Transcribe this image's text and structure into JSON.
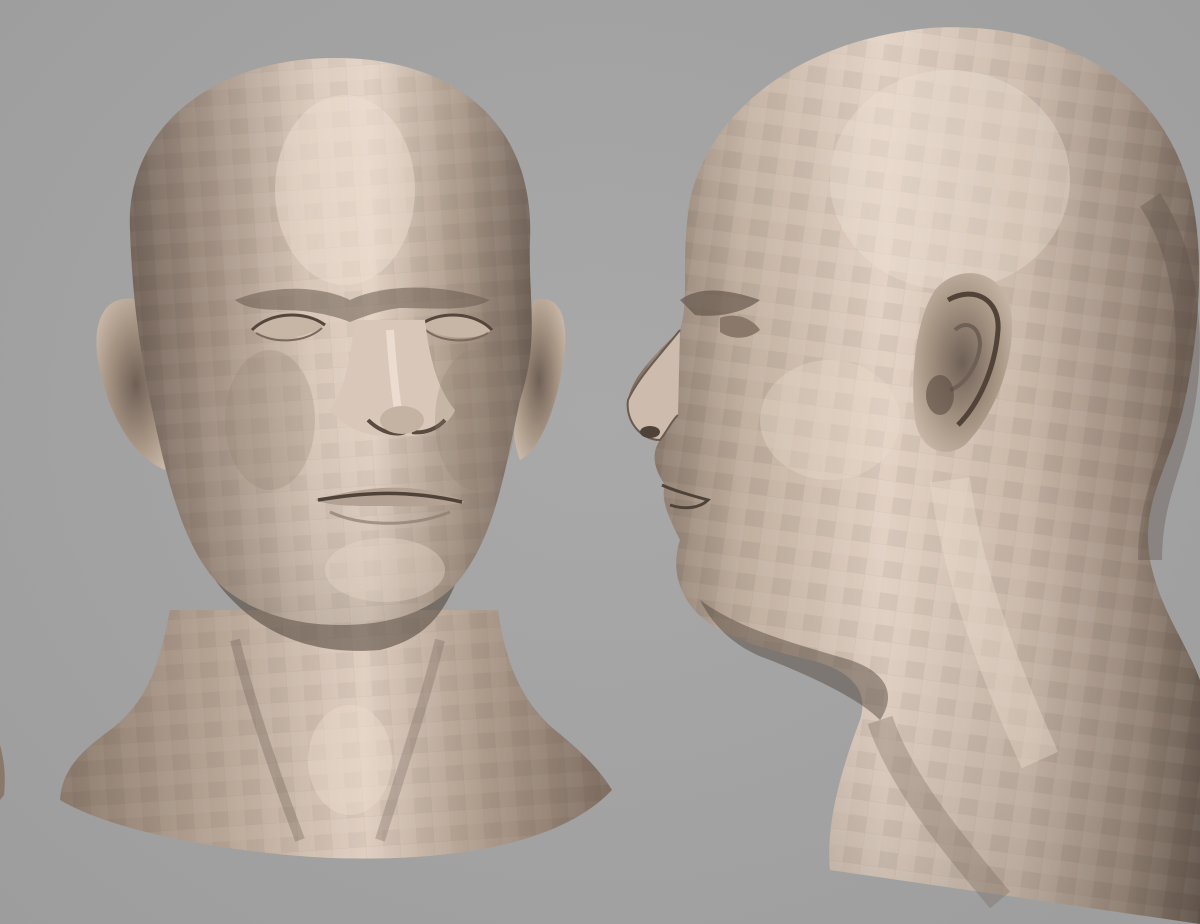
{
  "scene": {
    "background_color": "#a3a3a3",
    "material_color": "#c4b3a3",
    "material_shadow_color": "#6f6056",
    "material_highlight_color": "#ead9cb",
    "subjects": [
      {
        "name": "front-view-head-model"
      },
      {
        "name": "side-view-head-model"
      }
    ]
  }
}
